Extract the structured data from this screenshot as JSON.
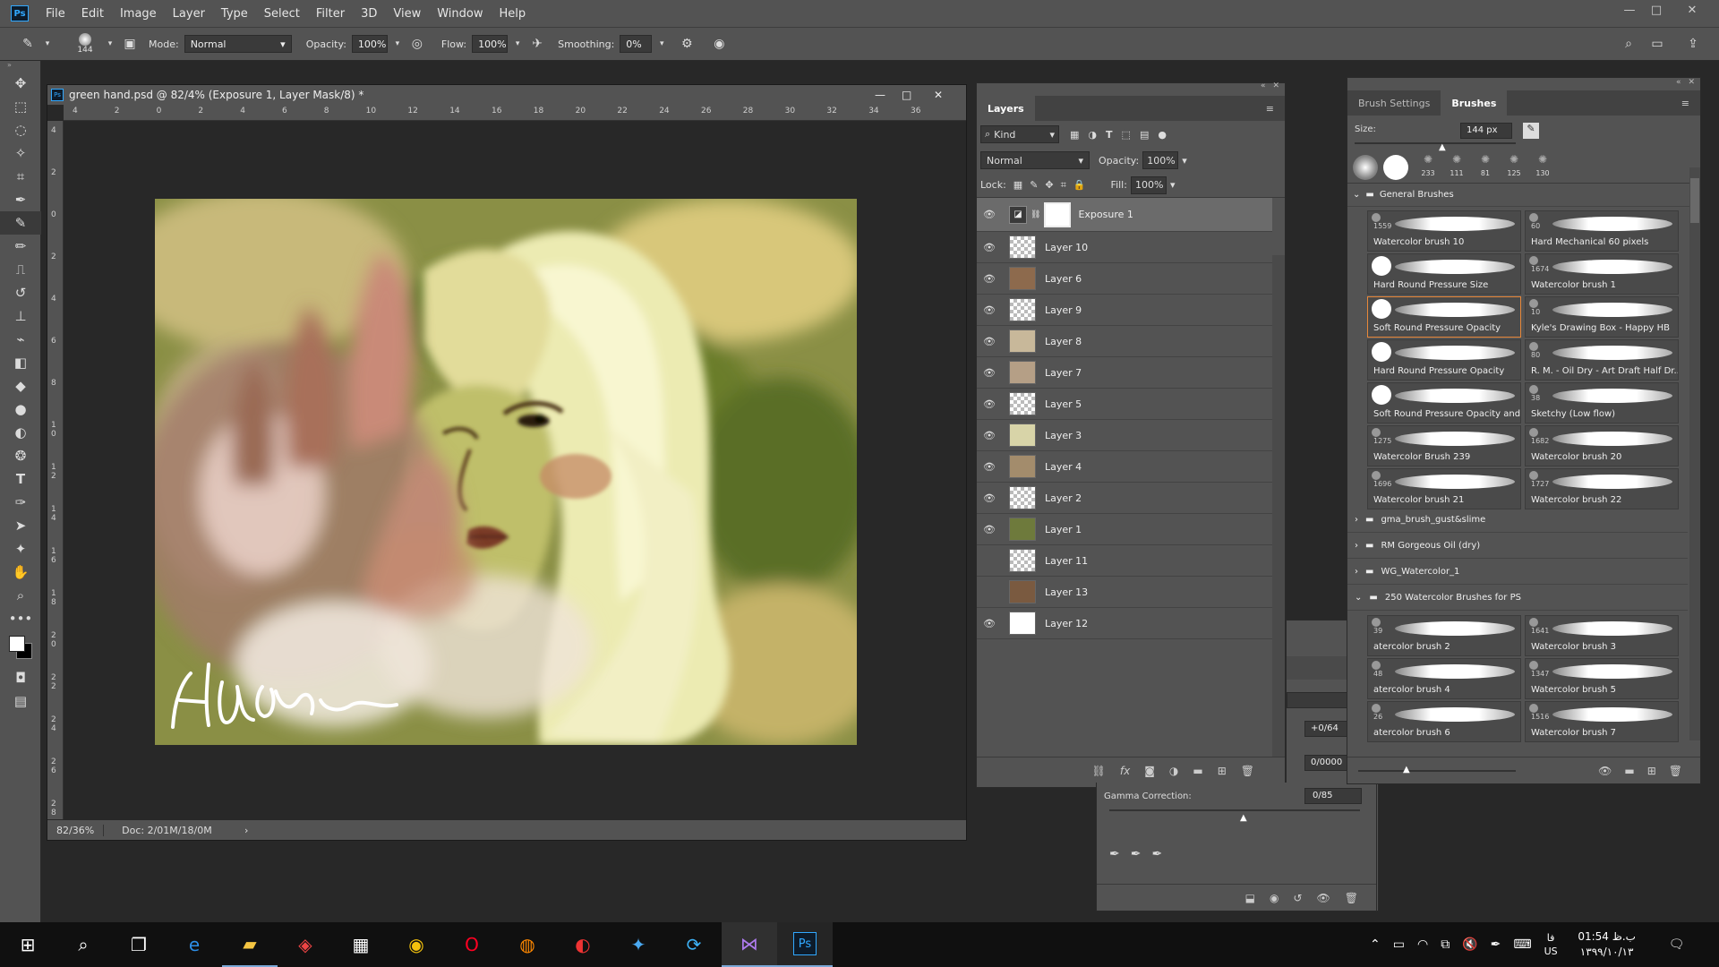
{
  "app": {
    "logo": "Ps"
  },
  "menu": [
    "File",
    "Edit",
    "Image",
    "Layer",
    "Type",
    "Select",
    "Filter",
    "3D",
    "View",
    "Window",
    "Help"
  ],
  "window_controls": {
    "minimize": "—",
    "maximize": "□",
    "close": "✕"
  },
  "options_bar": {
    "brush_size": "144",
    "mode_label": "Mode:",
    "mode_value": "Normal",
    "opacity_label": "Opacity:",
    "opacity_value": "100%",
    "flow_label": "Flow:",
    "flow_value": "100%",
    "smoothing_label": "Smoothing:",
    "smoothing_value": "0%"
  },
  "document": {
    "title": "green hand.psd @ 82/4% (Exposure 1, Layer Mask/8) *",
    "zoom": "82/36%",
    "doc_info": "Doc: 2/01M/18/0M",
    "ruler_h": [
      "4",
      "2",
      "0",
      "2",
      "4",
      "6",
      "8",
      "10",
      "12",
      "14",
      "16",
      "18",
      "20",
      "22",
      "24",
      "26",
      "28",
      "30",
      "32",
      "34",
      "36"
    ],
    "ruler_v": [
      "4",
      "2",
      "0",
      "2",
      "4",
      "6",
      "8",
      "1 0",
      "1 2",
      "1 4",
      "1 6",
      "1 8",
      "2 0",
      "2 2",
      "2 4",
      "2 6",
      "2 8"
    ],
    "signature": "AldeAorain"
  },
  "layers_panel": {
    "tab": "Layers",
    "filter_label": "Kind",
    "blend_mode": "Normal",
    "opacity_label": "Opacity:",
    "opacity_value": "100%",
    "lock_label": "Lock:",
    "fill_label": "Fill:",
    "fill_value": "100%",
    "layers": [
      {
        "name": "Exposure 1",
        "visible": true,
        "selected": true,
        "type": "adjustment"
      },
      {
        "name": "Layer 10",
        "visible": true
      },
      {
        "name": "Layer 6",
        "visible": true
      },
      {
        "name": "Layer 9",
        "visible": true
      },
      {
        "name": "Layer 8",
        "visible": true
      },
      {
        "name": "Layer 7",
        "visible": true
      },
      {
        "name": "Layer 5",
        "visible": true
      },
      {
        "name": "Layer 3",
        "visible": true
      },
      {
        "name": "Layer 4",
        "visible": true
      },
      {
        "name": "Layer 2",
        "visible": true
      },
      {
        "name": "Layer 1",
        "visible": true
      },
      {
        "name": "Layer 11",
        "visible": false
      },
      {
        "name": "Layer 13",
        "visible": false
      },
      {
        "name": "Layer 12",
        "visible": true
      }
    ]
  },
  "properties_panel": {
    "offset_value": "+0/64",
    "second_value": "0/0000",
    "gamma_label": "Gamma Correction:",
    "gamma_value": "0/85"
  },
  "brushes_panel": {
    "tabs": [
      "Brush Settings",
      "Brushes"
    ],
    "size_label": "Size:",
    "size_value": "144 px",
    "presets": [
      "233",
      "111",
      "81",
      "125",
      "130"
    ],
    "group_general": "General Brushes",
    "brushes": [
      {
        "num": "1559",
        "name": "Watercolor brush 10"
      },
      {
        "num": "60",
        "name": "Hard Mechanical 60 pixels"
      },
      {
        "num": "",
        "name": "Hard Round Pressure Size"
      },
      {
        "num": "1674",
        "name": "Watercolor brush 1"
      },
      {
        "num": "",
        "name": "Soft Round Pressure Opacity",
        "selected": true
      },
      {
        "num": "10",
        "name": "Kyle's Drawing Box - Happy HB"
      },
      {
        "num": "",
        "name": "Hard Round Pressure Opacity"
      },
      {
        "num": "80",
        "name": "R. M. - Oil Dry - Art Draft Half Dr..."
      },
      {
        "num": "",
        "name": "Soft Round Pressure Opacity and..."
      },
      {
        "num": "38",
        "name": "Sketchy (Low flow)"
      },
      {
        "num": "1275",
        "name": "Watercolor Brush 239"
      },
      {
        "num": "1682",
        "name": "Watercolor brush 20"
      },
      {
        "num": "1696",
        "name": "Watercolor brush 21"
      },
      {
        "num": "1727",
        "name": "Watercolor brush 22"
      }
    ],
    "groups": [
      "gma_brush_gust&slime",
      "RM Gorgeous Oil (dry)",
      "WG_Watercolor_1",
      "250 Watercolor Brushes for PS"
    ],
    "brushes2": [
      {
        "num": "39",
        "name": "atercolor brush 2"
      },
      {
        "num": "1641",
        "name": "Watercolor brush 3"
      },
      {
        "num": "48",
        "name": "atercolor brush 4"
      },
      {
        "num": "1347",
        "name": "Watercolor brush 5"
      },
      {
        "num": "26",
        "name": "atercolor brush 6"
      },
      {
        "num": "1516",
        "name": "Watercolor brush 7"
      }
    ]
  },
  "taskbar": {
    "time": "01:54 ب.ظ",
    "date": "۱۳۹۹/۱۰/۱۳",
    "lang_top": "فا",
    "lang_bottom": "US",
    "ps_label": "Ps"
  }
}
